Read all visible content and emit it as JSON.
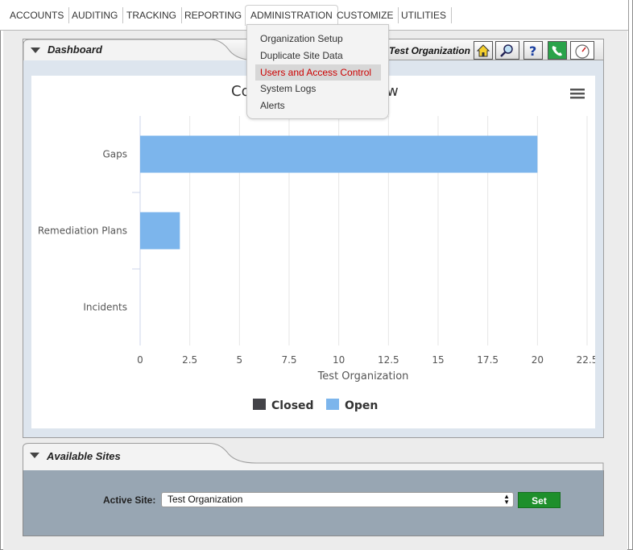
{
  "nav": {
    "items": [
      "ACCOUNTS",
      "AUDITING",
      "TRACKING",
      "REPORTING",
      "ADMINISTRATION",
      "CUSTOMIZE",
      "UTILITIES"
    ],
    "active": "ADMINISTRATION"
  },
  "admin_menu": {
    "items": [
      "Organization Setup",
      "Duplicate Site Data",
      "Users and Access Control",
      "System Logs",
      "Alerts"
    ],
    "highlighted": "Users and Access Control"
  },
  "dashboard": {
    "title": "Dashboard",
    "org_label": "Test Organization",
    "toolbar_icons": [
      "home-icon",
      "search-icon",
      "help-icon",
      "phone-icon",
      "gauge-icon"
    ],
    "chart_title_left": "Co",
    "chart_title_right": "w"
  },
  "chart_data": {
    "type": "bar",
    "orientation": "horizontal",
    "categories": [
      "Gaps",
      "Remediation Plans",
      "Incidents"
    ],
    "series": [
      {
        "name": "Closed",
        "values": [
          0,
          0,
          0
        ],
        "color": "#434348"
      },
      {
        "name": "Open",
        "values": [
          20,
          2,
          0
        ],
        "color": "#7cb5ec"
      }
    ],
    "xlabel": "Test Organization",
    "xticks": [
      "0",
      "2.5",
      "5",
      "7.5",
      "10",
      "12.5",
      "15",
      "17.5",
      "20",
      "22.5"
    ],
    "xlim": [
      0,
      22.5
    ],
    "grid": true,
    "legend": "bottom-center"
  },
  "sites": {
    "title": "Available Sites",
    "active_label": "Active Site:",
    "selected": "Test Organization",
    "set_label": "Set"
  }
}
